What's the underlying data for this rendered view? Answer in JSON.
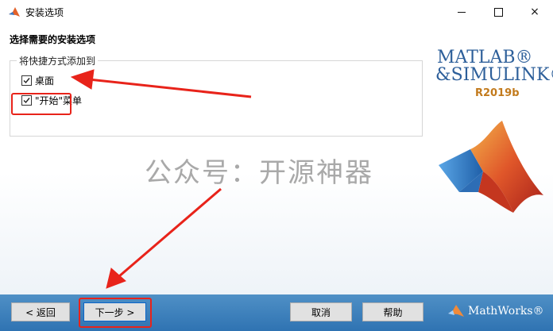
{
  "window": {
    "title": "安装选项",
    "controls": {
      "minimize": "minimize-icon",
      "maximize": "maximize-icon",
      "close": "×"
    }
  },
  "main": {
    "heading": "选择需要的安装选项",
    "group": {
      "legend": "将快捷方式添加到",
      "options": [
        {
          "label": "桌面",
          "checked": true
        },
        {
          "label": "\"开始\"菜单",
          "checked": true
        }
      ]
    },
    "watermark": "公众号：开源神器"
  },
  "branding": {
    "matlab": "MATLAB®",
    "simulink": "&SIMULINK®",
    "release": "R2019b",
    "vendor": "MathWorks®"
  },
  "footer": {
    "back": "< 返回",
    "next": "下一步 >",
    "cancel": "取消",
    "help": "帮助"
  },
  "annotations": {
    "highlight_color": "#e8231a"
  },
  "colors": {
    "brand_blue": "#2d5f9a",
    "footer_blue": "#2f73b2",
    "release_orange": "#c27a1c"
  }
}
